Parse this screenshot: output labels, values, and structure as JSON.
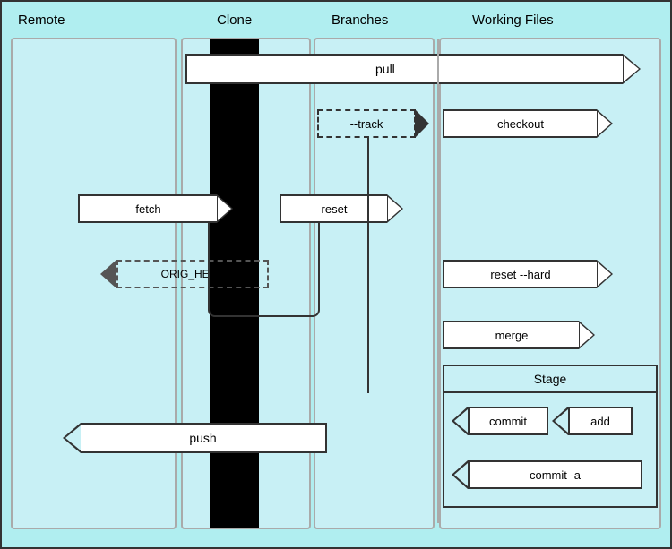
{
  "columns": {
    "remote": "Remote",
    "clone": "Clone",
    "branches": "Branches",
    "working": "Working Files"
  },
  "commands": {
    "pull": "pull",
    "track": "--track",
    "checkout": "checkout",
    "fetch": "fetch",
    "reset": "reset",
    "reset_hard": "reset --hard",
    "merge": "merge",
    "stage": "Stage",
    "commit": "commit",
    "add": "add",
    "commit_a": "commit -a",
    "push": "push",
    "ORIG_HEAD": "ORIG_HEAD"
  },
  "colors": {
    "background": "#b0eef0",
    "section_bg": "#c8f0f5",
    "border": "#aaa",
    "arrow_bg": "#ffffff",
    "text": "#000000"
  }
}
